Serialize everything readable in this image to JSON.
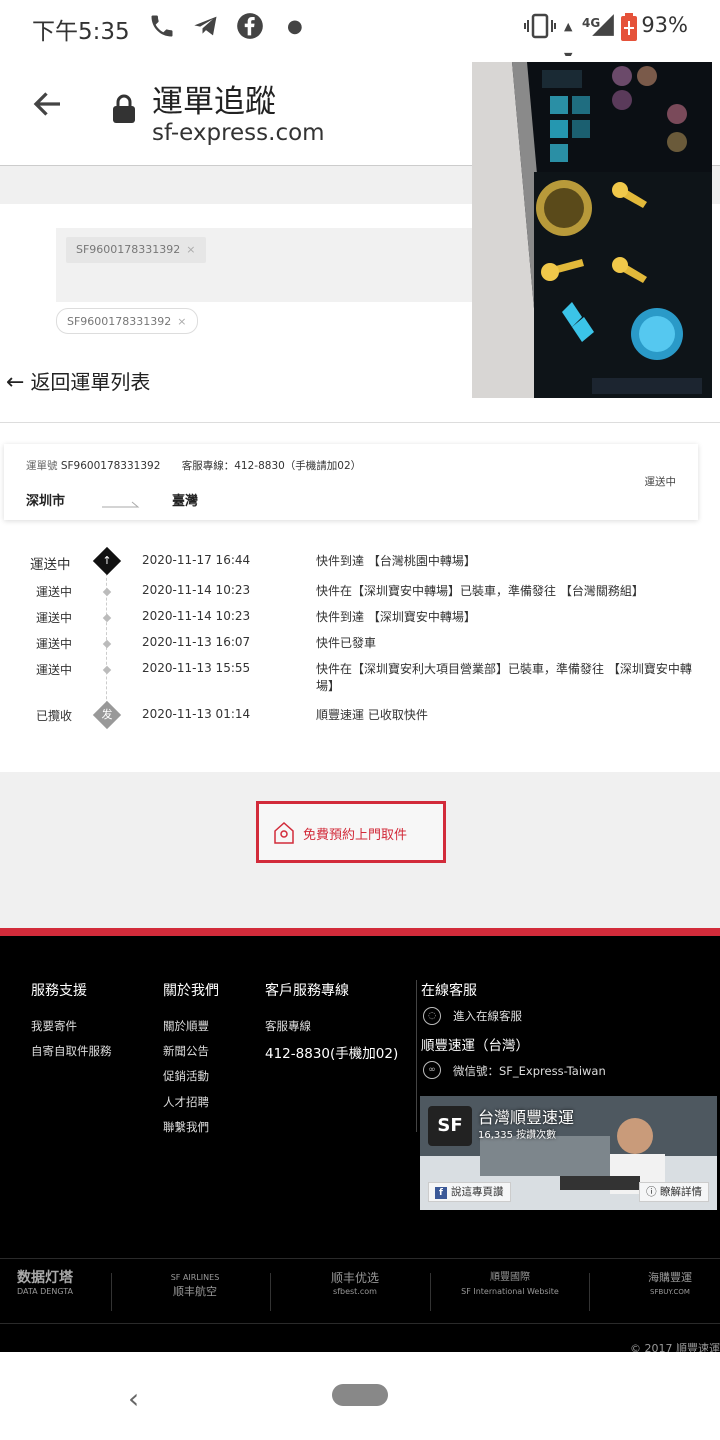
{
  "status_bar": {
    "time": "下午5:35",
    "network": "4G",
    "battery": "93%"
  },
  "browser": {
    "title": "運單追蹤",
    "host": "sf-express.com"
  },
  "search": {
    "chips": [
      "SF9600178331392",
      "SF9600178331392"
    ]
  },
  "back_to_list": "返回運單列表",
  "waybill": {
    "number_label": "運單號",
    "number": "SF9600178331392",
    "service": "客服專線：412-8830（手機請加02）",
    "from": "深圳市",
    "to": "臺灣",
    "status": "運送中"
  },
  "timeline": [
    {
      "status": "運送中",
      "time": "2020-11-17 16:44",
      "desc": "快件到達 【台灣桃園中轉場】"
    },
    {
      "status": "運送中",
      "time": "2020-11-14 10:23",
      "desc": "快件在【深圳寶安中轉場】已裝車，準備發往 【台灣關務組】"
    },
    {
      "status": "運送中",
      "time": "2020-11-14 10:23",
      "desc": "快件到達 【深圳寶安中轉場】"
    },
    {
      "status": "運送中",
      "time": "2020-11-13 16:07",
      "desc": "快件已發車"
    },
    {
      "status": "運送中",
      "time": "2020-11-13 15:55",
      "desc": "快件在【深圳寶安利大項目營業部】已裝車，準備發往 【深圳寶安中轉場】"
    },
    {
      "status": "已攬收",
      "time": "2020-11-13 01:14",
      "desc": "順豐速運 已收取快件"
    }
  ],
  "timeline_icons": {
    "first": "↑",
    "last": "发"
  },
  "pickup_button": "免費預約上門取件",
  "footer": {
    "support": {
      "title": "服務支援",
      "links": [
        "我要寄件",
        "自寄自取件服務"
      ]
    },
    "about": {
      "title": "關於我們",
      "links": [
        "關於順豐",
        "新聞公告",
        "促銷活動",
        "人才招聘",
        "聯繫我們"
      ]
    },
    "service_line": {
      "title": "客戶服務專線",
      "label": "客服專線",
      "phone": "412-8830(手機加02)"
    },
    "online": {
      "title": "在線客服",
      "enter": "進入在線客服",
      "company": "順豐速運（台灣）",
      "wechat": "微信號：SF_Express-Taiwan"
    },
    "fb": {
      "name": "台灣順豐速運",
      "likes": "16,335 按讚次數",
      "like_btn": "說這專頁讚",
      "more_btn": "瞭解詳情",
      "logo": "SF"
    },
    "logos": [
      {
        "top": "数据灯塔",
        "bottom": "DATA DENGTA"
      },
      {
        "top": "SF AIRLINES",
        "bottom": "顺丰航空"
      },
      {
        "top": "顺丰优选",
        "bottom": "sfbest.com"
      },
      {
        "top": "順豐國際",
        "bottom": "SF International Website"
      },
      {
        "top": "海購豐運",
        "bottom": "SFBUY.COM"
      }
    ],
    "copyright": "© 2017 順豐速運"
  }
}
